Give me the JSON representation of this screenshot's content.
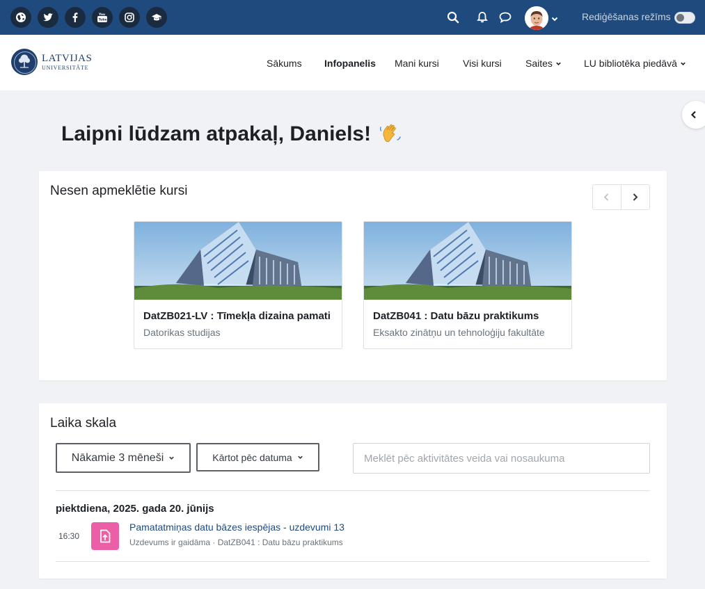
{
  "topbar": {
    "social_icons": [
      "globe-icon",
      "twitter-icon",
      "facebook-icon",
      "youtube-icon",
      "instagram-icon",
      "graduation-cap-icon"
    ],
    "edit_mode_label": "Rediģēšanas režīms",
    "edit_mode_on": false
  },
  "nav": {
    "logo_line1": "LATVIJAS",
    "logo_line2": "UNIVERSITĀTE",
    "items": [
      {
        "label": "Sākums",
        "active": false
      },
      {
        "label": "Infopanelis",
        "active": true
      },
      {
        "label": "Mani kursi",
        "active": false
      },
      {
        "label": "Visi kursi",
        "active": false
      },
      {
        "label": "Saites",
        "active": false,
        "dropdown": true
      },
      {
        "label": "LU bibliotēka piedāvā",
        "active": false,
        "dropdown": true
      }
    ]
  },
  "welcome": "Laipni lūdzam atpakaļ, Daniels!",
  "recent": {
    "title": "Nesen apmeklētie kursi",
    "courses": [
      {
        "name": "DatZB021-LV : Tīmekļa dizaina pamati",
        "category": "Datorikas studijas"
      },
      {
        "name": "DatZB041 : Datu bāzu praktikums",
        "category": "Eksakto zinātņu un tehnoloģiju fakultāte"
      }
    ]
  },
  "timeline": {
    "title": "Laika skala",
    "filter_label": "Nākamie 3 mēneši",
    "sort_label": "Kārtot pēc datuma",
    "search_placeholder": "Meklēt pēc aktivitātes veida vai nosaukuma",
    "day": "piektdiena, 2025. gada 20. jūnijs",
    "event": {
      "time": "16:30",
      "title": "Pamatatmiņas datu bāzes iespējas - uzdevumi 13",
      "subtitle": "Uzdevums ir gaidāma · DatZB041 : Datu bāzu praktikums"
    }
  },
  "colors": {
    "topbar": "#1f4a7e",
    "assignment_icon": "#ea5fa5",
    "link": "#1f4a7e"
  }
}
